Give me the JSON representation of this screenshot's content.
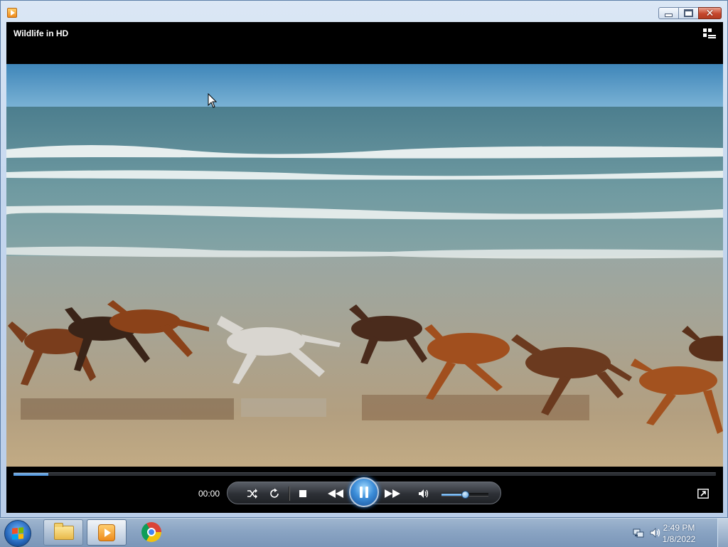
{
  "window": {
    "app_icon": "media-player-icon",
    "buttons": [
      "minimize",
      "maximize",
      "close"
    ]
  },
  "player": {
    "video_title": "Wildlife in HD",
    "current_time": "00:00",
    "seek_progress": 0.05,
    "volume_level": 0.5,
    "state": "playing",
    "accent_color": "#3d8ed9",
    "controls": [
      "shuffle-icon",
      "repeat-icon",
      "stop-icon",
      "previous-icon",
      "pause-icon",
      "next-icon",
      "volume-icon"
    ]
  },
  "taskbar": {
    "items": [
      "start-button",
      "windows-explorer",
      "windows-media-player",
      "google-chrome"
    ],
    "clock": {
      "time": "2:49 PM",
      "date": "1/8/2022"
    },
    "tray_icons": [
      "network-icon",
      "volume-icon"
    ]
  }
}
